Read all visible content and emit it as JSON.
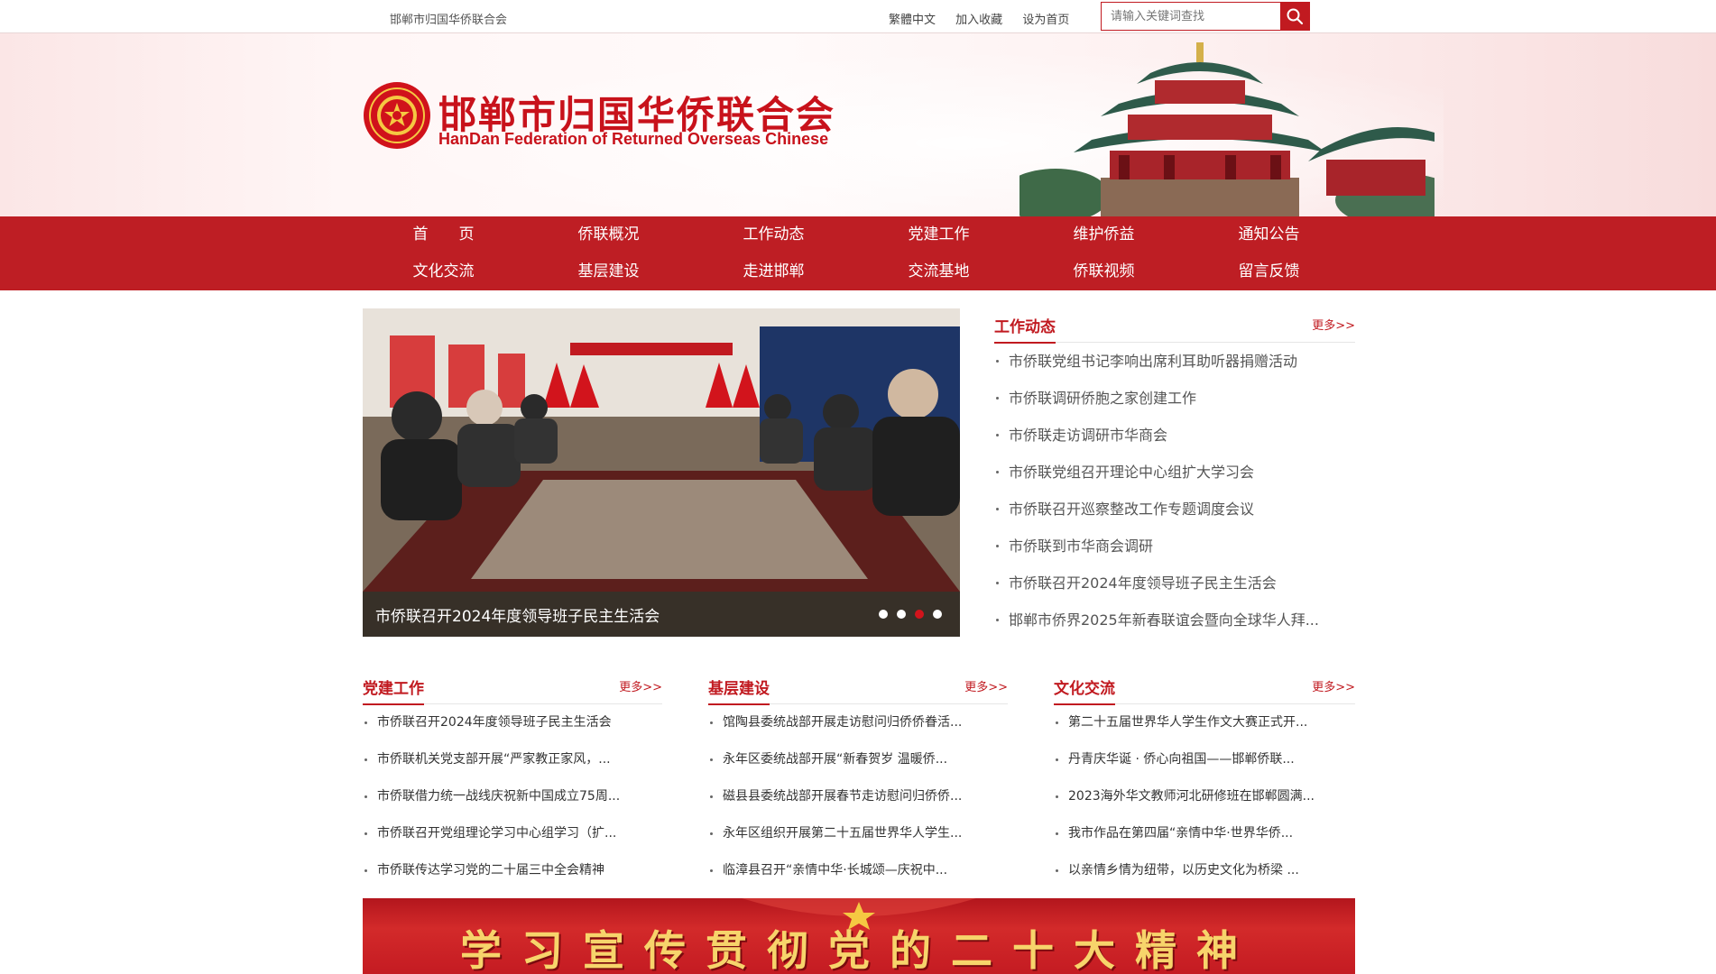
{
  "topbar": {
    "site_name": "邯郸市归国华侨联合会",
    "links": [
      "繁體中文",
      "加入收藏",
      "设为首页"
    ],
    "search_placeholder": "请输入关键词查找"
  },
  "header": {
    "title_cn": "邯郸市归国华侨联合会",
    "title_en": "HanDan Federation of Returned Overseas Chinese"
  },
  "nav": {
    "row1": [
      "首　　页",
      "侨联概况",
      "工作动态",
      "党建工作",
      "维护侨益",
      "通知公告"
    ],
    "row2": [
      "文化交流",
      "基层建设",
      "走进邯郸",
      "交流基地",
      "侨联视频",
      "留言反馈"
    ]
  },
  "slider": {
    "caption": "市侨联召开2024年度领导班子民主生活会",
    "dot_count": 4,
    "active_dot": 3
  },
  "work_news": {
    "title": "工作动态",
    "more": "更多>>",
    "items": [
      "市侨联党组书记李响出席利耳助听器捐赠活动",
      "市侨联调研侨胞之家创建工作",
      "市侨联走访调研市华商会",
      "市侨联党组召开理论中心组扩大学习会",
      "市侨联召开巡察整改工作专题调度会议",
      "市侨联到市华商会调研",
      "市侨联召开2024年度领导班子民主生活会",
      "邯郸市侨界2025年新春联谊会暨向全球华人拜..."
    ]
  },
  "party_work": {
    "title": "党建工作",
    "more": "更多>>",
    "items": [
      "市侨联召开2024年度领导班子民主生活会",
      "市侨联机关党支部开展“严家教正家风，...",
      "市侨联借力统一战线庆祝新中国成立75周...",
      "市侨联召开党组理论学习中心组学习（扩...",
      "市侨联传达学习党的二十届三中全会精神"
    ]
  },
  "grassroots": {
    "title": "基层建设",
    "more": "更多>>",
    "items": [
      "馆陶县委统战部开展走访慰问归侨侨眷活...",
      "永年区委统战部开展“新春贺岁 温暖侨...",
      "磁县县委统战部开展春节走访慰问归侨侨...",
      "永年区组织开展第二十五届世界华人学生...",
      "临漳县召开“亲情中华·长城颂—庆祝中..."
    ]
  },
  "culture": {
    "title": "文化交流",
    "more": "更多>>",
    "items": [
      "第二十五届世界华人学生作文大赛正式开...",
      "丹青庆华诞 · 侨心向祖国——邯郸侨联...",
      "2023海外华文教师河北研修班在邯郸圆满...",
      "我市作品在第四届“亲情中华·世界华侨...",
      "以亲情乡情为纽带，以历史文化为桥梁 ..."
    ]
  },
  "bottom_banner": {
    "slogan": "学习宣传贯彻党的二十大精神"
  },
  "colors": {
    "brand_red": "#be1e24",
    "title_red": "#c11a20",
    "slogan_gold": "#f7d46b"
  }
}
